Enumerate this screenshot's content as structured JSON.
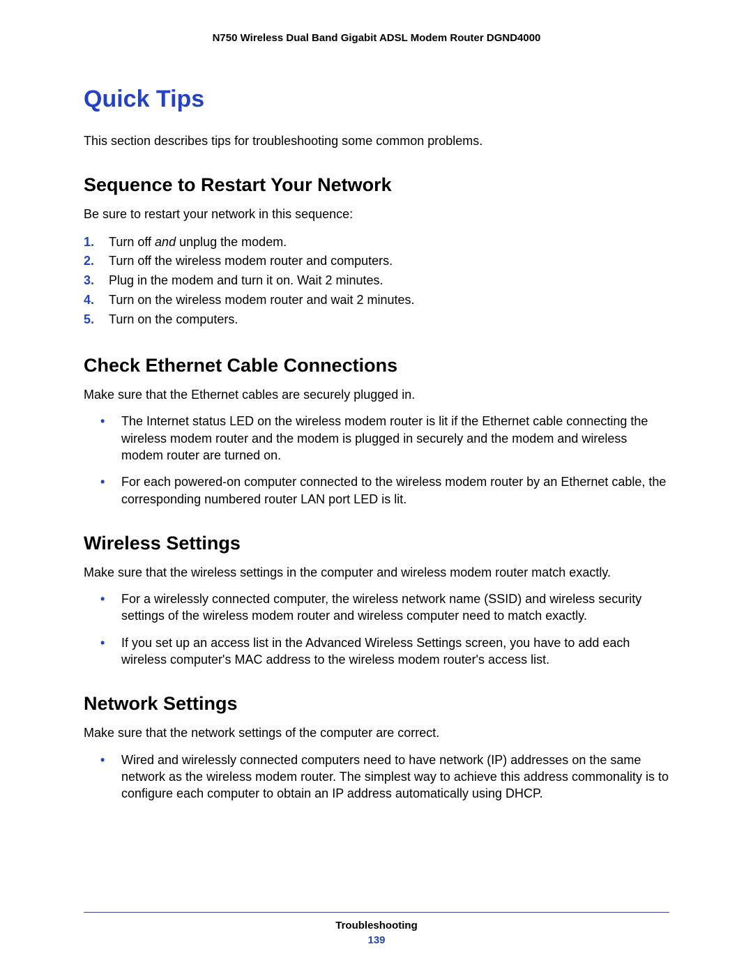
{
  "header": "N750 Wireless Dual Band Gigabit ADSL Modem Router DGND4000",
  "title": "Quick Tips",
  "intro": "This section describes tips for troubleshooting some common problems.",
  "sections": {
    "restart": {
      "heading": "Sequence to Restart Your Network",
      "lead": "Be sure to restart your network in this sequence:",
      "items": [
        {
          "n": "1.",
          "pre": "Turn off ",
          "em": "and",
          "post": " unplug the modem."
        },
        {
          "n": "2.",
          "text": "Turn off the wireless modem router and computers."
        },
        {
          "n": "3.",
          "text": "Plug in the modem and turn it on. Wait 2 minutes."
        },
        {
          "n": "4.",
          "text": "Turn on the wireless modem router and wait 2 minutes."
        },
        {
          "n": "5.",
          "text": "Turn on the computers."
        }
      ]
    },
    "ethernet": {
      "heading": "Check Ethernet Cable Connections",
      "lead": "Make sure that the Ethernet cables are securely plugged in.",
      "items": [
        "The Internet status LED on the wireless modem router is lit if the Ethernet cable connecting the wireless modem router and the modem is plugged in securely and the modem and wireless modem router are turned on.",
        "For each powered-on computer connected to the wireless modem router by an Ethernet cable, the corresponding numbered router LAN port LED is lit."
      ]
    },
    "wireless": {
      "heading": "Wireless Settings",
      "lead": "Make sure that the wireless settings in the computer and wireless modem router match exactly.",
      "items": [
        "For a wirelessly connected computer, the wireless network name (SSID) and wireless security settings of the wireless modem router and wireless computer need to match exactly.",
        "If you set up an access list in the Advanced Wireless Settings screen, you have to add each wireless computer's MAC address to the wireless modem router's access list."
      ]
    },
    "network": {
      "heading": "Network Settings",
      "lead": "Make sure that the network settings of the computer are correct.",
      "items": [
        "Wired and wirelessly connected computers need to have network (IP) addresses on the same network as the wireless modem router. The simplest way to achieve this address commonality is to configure each computer to obtain an IP address automatically using DHCP."
      ]
    }
  },
  "footer": {
    "section": "Troubleshooting",
    "page": "139"
  }
}
